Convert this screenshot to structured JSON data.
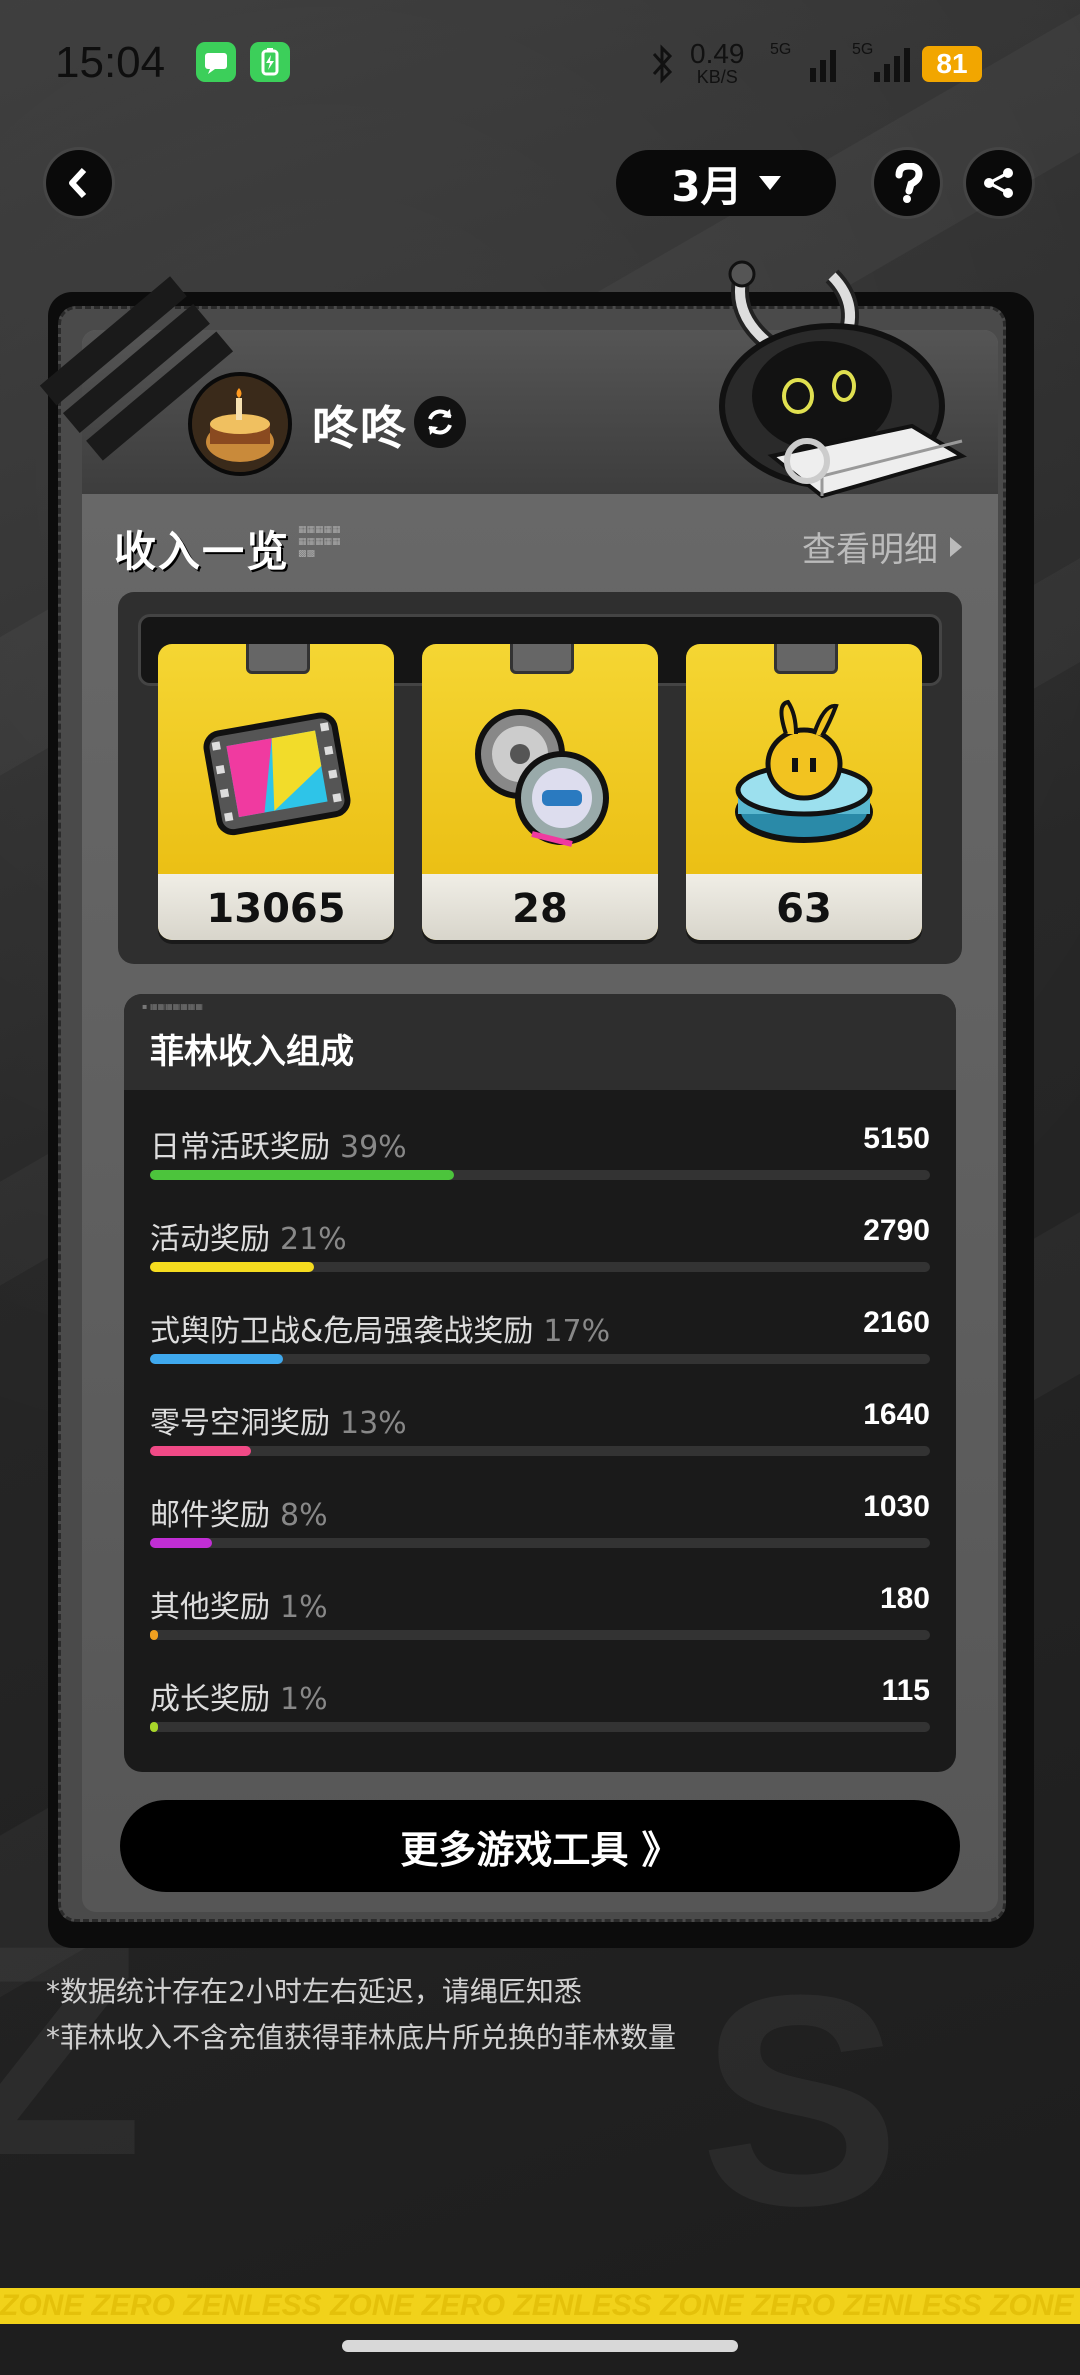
{
  "status_bar": {
    "time": "15:04",
    "net_speed": "0.49",
    "net_unit": "KB/S",
    "sig1_label": "5G",
    "sig2_label": "5G",
    "battery": "81"
  },
  "header": {
    "month": "3月"
  },
  "profile": {
    "username": "咚咚"
  },
  "income": {
    "title": "收入一览",
    "detail_link": "查看明细",
    "currencies": [
      {
        "icon": "film-reel-icon",
        "value": "13065"
      },
      {
        "icon": "film-canisters-icon",
        "value": "28"
      },
      {
        "icon": "bangboo-trophy-icon",
        "value": "63"
      }
    ]
  },
  "composition": {
    "title": "菲林收入组成",
    "rows": [
      {
        "label": "日常活跃奖励",
        "pct": "39%",
        "value": "5150",
        "fraction": 0.39,
        "color": "#4cc43c"
      },
      {
        "label": "活动奖励",
        "pct": "21%",
        "value": "2790",
        "fraction": 0.21,
        "color": "#f5dc1f"
      },
      {
        "label": "式舆防卫战&危局强袭战奖励",
        "pct": "17%",
        "value": "2160",
        "fraction": 0.17,
        "color": "#3fa9ee"
      },
      {
        "label": "零号空洞奖励",
        "pct": "13%",
        "value": "1640",
        "fraction": 0.13,
        "color": "#f04a86"
      },
      {
        "label": "邮件奖励",
        "pct": "8%",
        "value": "1030",
        "fraction": 0.08,
        "color": "#c12ed4"
      },
      {
        "label": "其他奖励",
        "pct": "1%",
        "value": "180",
        "fraction": 0.01,
        "color": "#f0a020"
      },
      {
        "label": "成长奖励",
        "pct": "1%",
        "value": "115",
        "fraction": 0.01,
        "color": "#a8d62a"
      }
    ]
  },
  "more_button": {
    "label": "更多游戏工具 》"
  },
  "notes": [
    "*数据统计存在2小时左右延迟，请绳匠知悉",
    "*菲林收入不含充值获得菲林底片所兑换的菲林数量"
  ],
  "bottom_strip": {
    "text": "ZONE ZERO ZENLESS ZONE ZERO ZENLESS ZONE ZERO ZENLESS ZONE"
  }
}
